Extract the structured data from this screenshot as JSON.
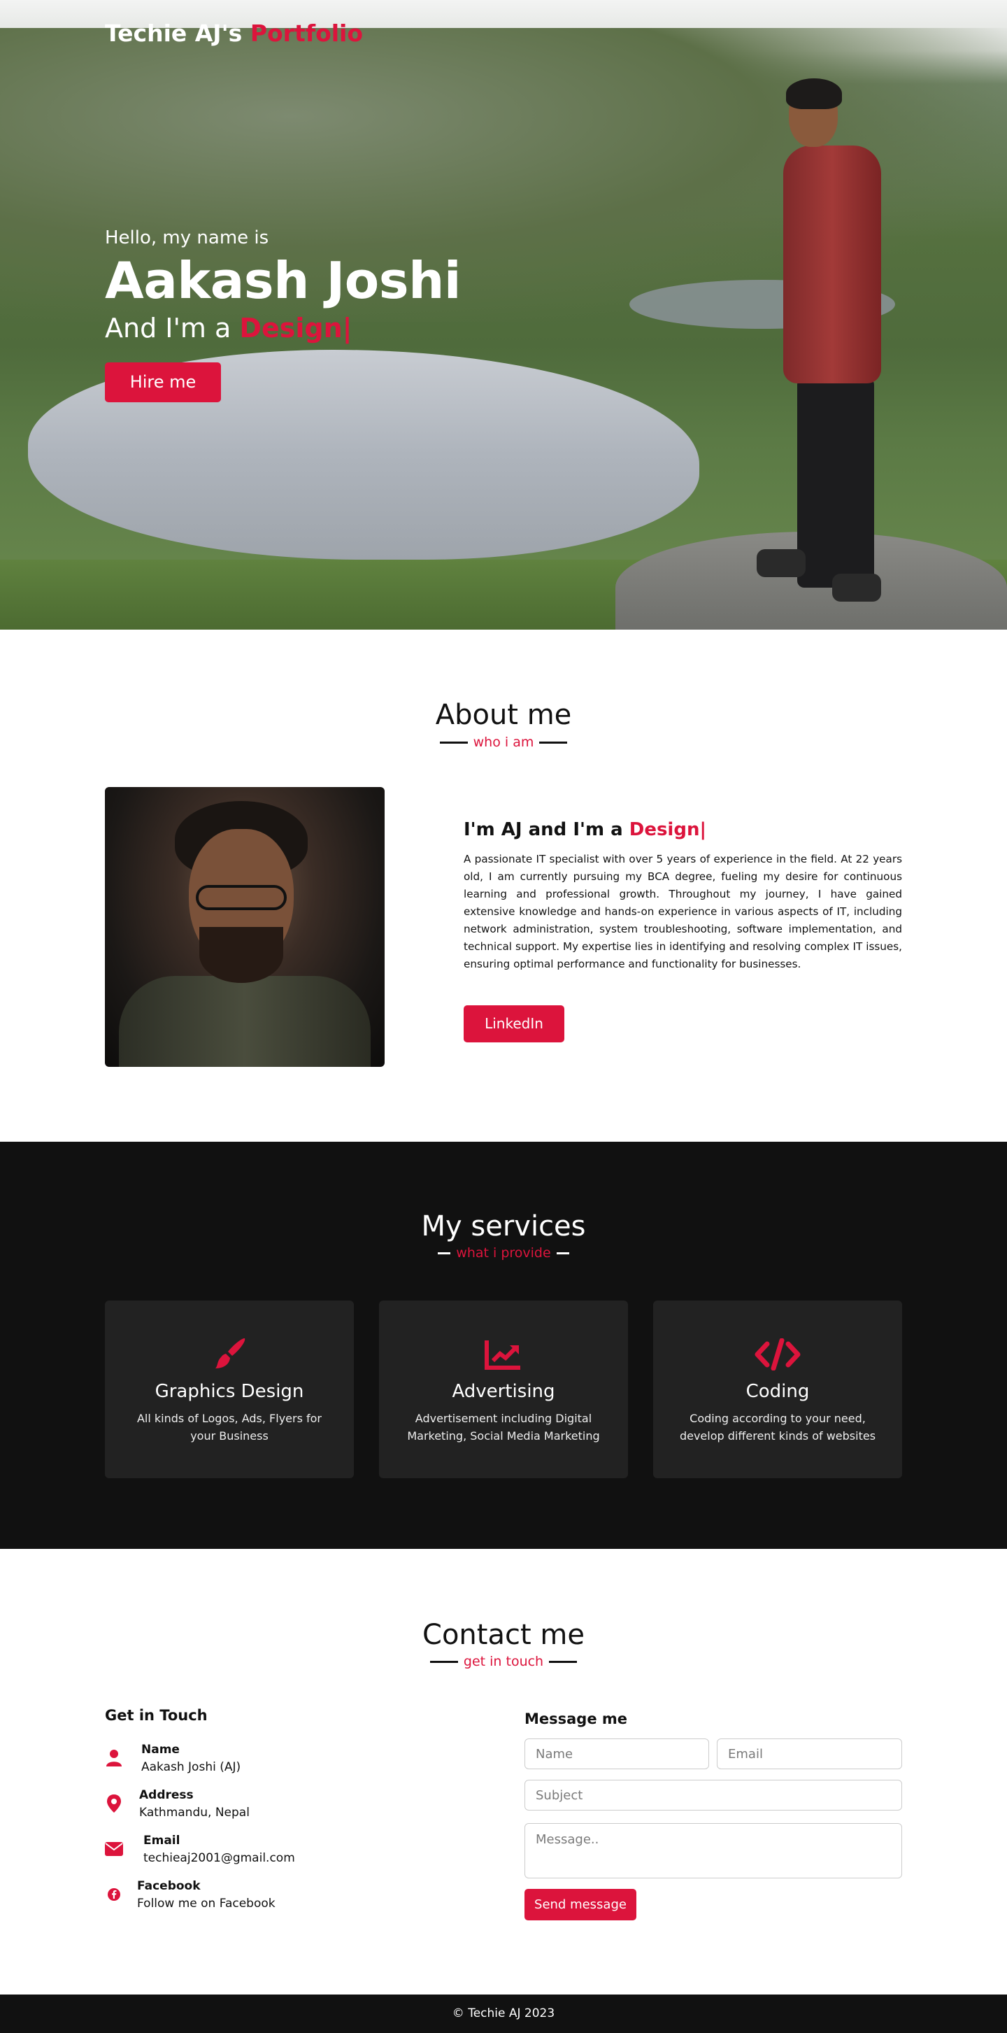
{
  "brand": {
    "name": "Techie AJ's",
    "accent": "Portfolio"
  },
  "hero": {
    "hello": "Hello, my name is",
    "name": "Aakash Joshi",
    "role_prefix": "And I'm a",
    "role_typed": "Design|",
    "hire_label": "Hire me"
  },
  "about": {
    "title": "About me",
    "subtitle": "who i am",
    "heading_prefix": "I'm AJ and I'm a",
    "heading_typed": "Design|",
    "paragraph": "A passionate IT specialist with over 5 years of experience in the field. At 22 years old, I am currently pursuing my BCA degree, fueling my desire for continuous learning and professional growth. Throughout my journey, I have gained extensive knowledge and hands-on experience in various aspects of IT, including network administration, system troubleshooting, software implementation, and technical support. My expertise lies in identifying and resolving complex IT issues, ensuring optimal performance and functionality for businesses.",
    "linkedin_label": "LinkedIn"
  },
  "services": {
    "title": "My services",
    "subtitle": "what i provide",
    "items": [
      {
        "icon": "paintbrush-icon",
        "title": "Graphics Design",
        "desc": "All kinds of Logos, Ads, Flyers for your Business"
      },
      {
        "icon": "chart-line-icon",
        "title": "Advertising",
        "desc": "Advertisement including Digital Marketing, Social Media Marketing"
      },
      {
        "icon": "code-icon",
        "title": "Coding",
        "desc": "Coding according to your need, develop different kinds of websites"
      }
    ]
  },
  "contact": {
    "title": "Contact me",
    "subtitle": "get in touch",
    "get_in_touch": "Get in Touch",
    "info": [
      {
        "icon": "user-icon",
        "label": "Name",
        "value": "Aakash Joshi (AJ)"
      },
      {
        "icon": "map-marker-icon",
        "label": "Address",
        "value": "Kathmandu, Nepal"
      },
      {
        "icon": "envelope-icon",
        "label": "Email",
        "value": "techieaj2001@gmail.com"
      },
      {
        "icon": "facebook-icon",
        "label": "Facebook",
        "value": "Follow me on Facebook"
      }
    ],
    "message_title": "Message me",
    "placeholders": {
      "name": "Name",
      "email": "Email",
      "subject": "Subject",
      "message": "Message.."
    },
    "send_label": "Send message"
  },
  "footer": {
    "text": "© Techie AJ 2023"
  },
  "colors": {
    "accent": "#dc143c",
    "dark": "#111111",
    "card": "#222222"
  }
}
